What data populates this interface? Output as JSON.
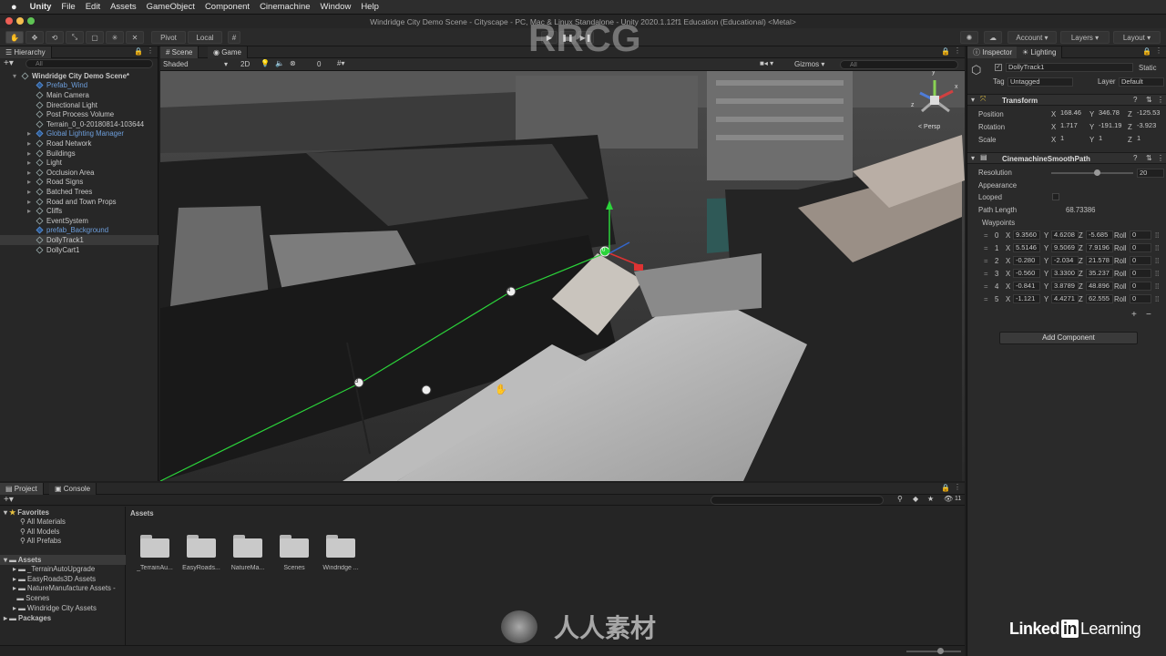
{
  "menubar": {
    "app": "Unity",
    "items": [
      "File",
      "Edit",
      "Assets",
      "GameObject",
      "Component",
      "Cinemachine",
      "Window",
      "Help"
    ]
  },
  "window_title": "Windridge City Demo Scene - Cityscape - PC, Mac & Linux Standalone - Unity 2020.1.12f1 Education (Educational) <Metal>",
  "toolbar": {
    "pivot": "Pivot",
    "local": "Local",
    "account": "Account",
    "layers": "Layers",
    "layout": "Layout"
  },
  "hierarchy": {
    "tab": "Hierarchy",
    "search_placeholder": "All",
    "items": [
      "Windridge City Demo Scene*",
      "Prefab_Wind",
      "Main Camera",
      "Directional Light",
      "Post Process Volume",
      "Terrain_0_0-20180814-103644",
      "Global Lighting Manager",
      "Road Network",
      "Buildings",
      "Light",
      "Occlusion Area",
      "Road Signs",
      "Batched Trees",
      "Road and Town Props",
      "Cliffs",
      "EventSystem",
      "prefab_Background",
      "DollyTrack1",
      "DollyCart1"
    ]
  },
  "scene": {
    "tab_scene": "Scene",
    "tab_game": "Game",
    "shading": "Shaded",
    "mode2d": "2D",
    "fx_count": "0",
    "gizmos": "Gizmos",
    "search_placeholder": "All",
    "persp": "< Persp",
    "axes": {
      "y": "y",
      "x": "x",
      "z": "z"
    },
    "waypoint_labels": [
      "3",
      "4",
      "0"
    ]
  },
  "inspector": {
    "tab_inspector": "Inspector",
    "tab_lighting": "Lighting",
    "object_name": "DollyTrack1",
    "static": "Static",
    "tag_label": "Tag",
    "tag_value": "Untagged",
    "layer_label": "Layer",
    "layer_value": "Default",
    "transform": {
      "title": "Transform",
      "rows": [
        {
          "label": "Position",
          "x": "168.46",
          "y": "346.78",
          "z": "-125.53"
        },
        {
          "label": "Rotation",
          "x": "1.717",
          "y": "-191.19",
          "z": "-3.923"
        },
        {
          "label": "Scale",
          "x": "1",
          "y": "1",
          "z": "1"
        }
      ]
    },
    "path": {
      "title": "CinemachineSmoothPath",
      "resolution_label": "Resolution",
      "resolution": "20",
      "resolution_fraction": 0.55,
      "appearance": "Appearance",
      "looped": "Looped",
      "path_length_label": "Path Length",
      "path_length": "68.73386",
      "waypoints_label": "Waypoints",
      "waypoints": [
        {
          "i": "0",
          "x": "9.3560",
          "y": "4.6208",
          "z": "-5.685",
          "roll": "0"
        },
        {
          "i": "1",
          "x": "5.5146",
          "y": "9.5069",
          "z": "7.9196",
          "roll": "0"
        },
        {
          "i": "2",
          "x": "-0.280",
          "y": "-2.034",
          "z": "21.578",
          "roll": "0"
        },
        {
          "i": "3",
          "x": "-0.560",
          "y": "3.3300",
          "z": "35.237",
          "roll": "0"
        },
        {
          "i": "4",
          "x": "-0.841",
          "y": "3.8789",
          "z": "48.896",
          "roll": "0"
        },
        {
          "i": "5",
          "x": "-1.121",
          "y": "4.4271",
          "z": "62.555",
          "roll": "0"
        }
      ]
    },
    "add_component": "Add Component",
    "plus": "+",
    "minus": "−",
    "roll_label": "Roll"
  },
  "project": {
    "tab_project": "Project",
    "tab_console": "Console",
    "favorites": "Favorites",
    "fav_items": [
      "All Materials",
      "All Models",
      "All Prefabs"
    ],
    "assets": "Assets",
    "asset_items": [
      "_TerrainAutoUpgrade",
      "EasyRoads3D Assets",
      "NatureManufacture Assets -",
      "Scenes",
      "Windridge City Assets"
    ],
    "packages": "Packages",
    "breadcrumb": "Assets",
    "hidden_count": "11",
    "folders": [
      "_TerrainAu...",
      "EasyRoads...",
      "NatureMa...",
      "Scenes",
      "Windridge ..."
    ]
  },
  "branding": {
    "linkedin": "Linked",
    "in": "in",
    "learning": "Learning",
    "watermark1": "RRCG",
    "watermark2": "人人素材"
  },
  "colors": {
    "accent": "#4a7fc1",
    "path_line": "#2bd43a",
    "prefab": "#6d9edb"
  }
}
